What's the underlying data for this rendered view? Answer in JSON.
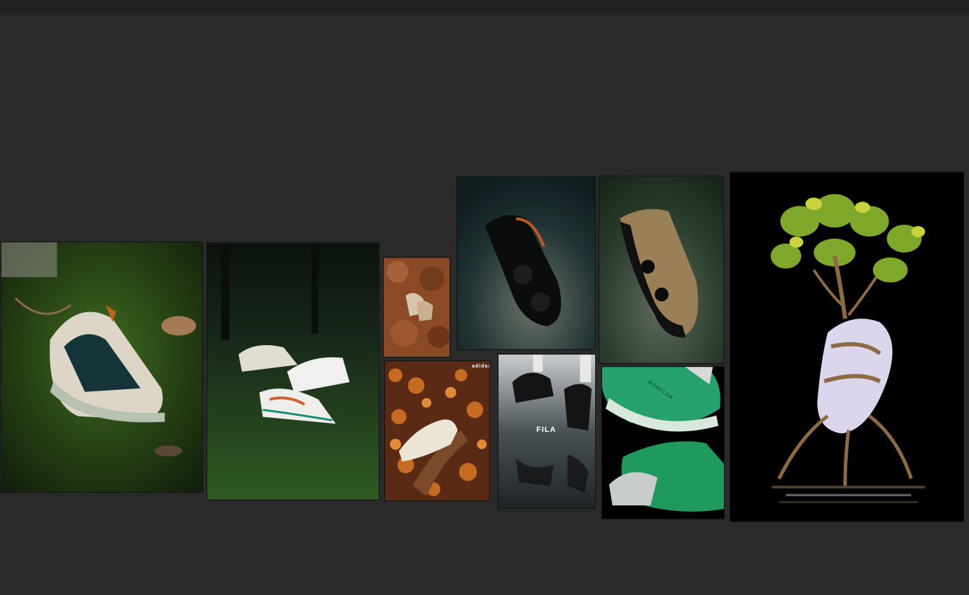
{
  "board": {
    "background": "#2a2a2a",
    "topbar_color": "#212121"
  },
  "images": [
    {
      "name": "asics-moss-butterfly-photo",
      "icon": "sneaker-on-moss"
    },
    {
      "name": "three-sneakers-forest-moss-photo",
      "icon": "sneakers-in-forest"
    },
    {
      "name": "sneakers-in-clay-photo",
      "icon": "sneakers-in-clay"
    },
    {
      "name": "black-sneaker-floating-photo",
      "icon": "floating-shoe"
    },
    {
      "name": "tan-sneaker-floating-photo",
      "icon": "floating-shoe"
    },
    {
      "name": "adidas-autumn-leaves-photo",
      "icon": "sneaker-in-leaves",
      "brand": "adidas"
    },
    {
      "name": "fila-reflection-photo",
      "icon": "sneakers-reflection",
      "brand": "FILA"
    },
    {
      "name": "moncler-green-sneakers-photo",
      "icon": "green-sneakers",
      "brand": "MONCLER"
    },
    {
      "name": "sneaker-mangrove-tree-photo",
      "icon": "sneaker-with-tree"
    }
  ]
}
